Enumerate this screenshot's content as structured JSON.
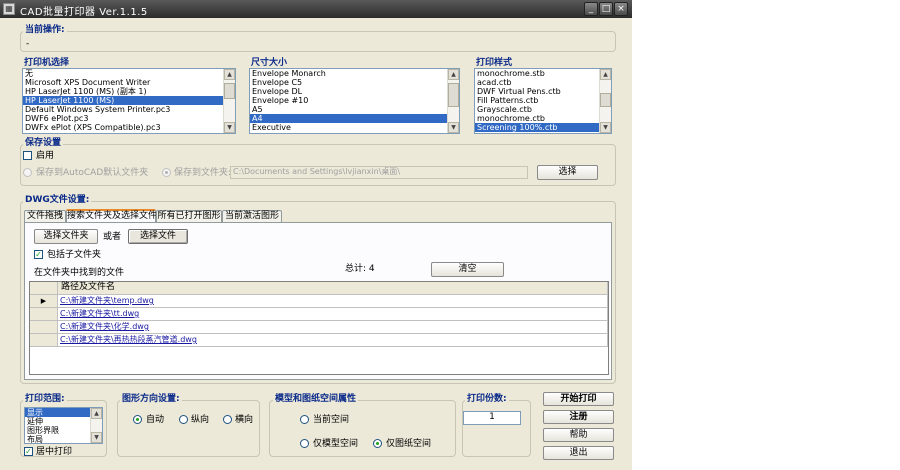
{
  "window": {
    "title": "CAD批量打印器 Ver.1.1.5",
    "controls": {
      "minimize": "_",
      "maximize": "□",
      "close": "×"
    }
  },
  "current_op": {
    "title": "当前操作:",
    "value": "-"
  },
  "printer": {
    "title": "打印机选择",
    "items": [
      "无",
      "Microsoft XPS Document Writer",
      "HP LaserJet 1100 (MS) (副本 1)",
      "HP LaserJet 1100 (MS)",
      "Default Windows System Printer.pc3",
      "DWF6 ePlot.pc3",
      "DWFx ePlot (XPS Compatible).pc3"
    ],
    "selected_index": 3
  },
  "size": {
    "title": "尺寸大小",
    "items": [
      "Envelope Monarch",
      "Envelope C5",
      "Envelope DL",
      "Envelope #10",
      "A5",
      "A4",
      "Executive"
    ],
    "selected_index": 5
  },
  "style": {
    "title": "打印样式",
    "items": [
      "monochrome.stb",
      "acad.ctb",
      "DWF Virtual Pens.ctb",
      "Fill Patterns.ctb",
      "Grayscale.ctb",
      "monochrome.ctb",
      "Screening 100%.ctb"
    ],
    "selected_index": 6
  },
  "save": {
    "title": "保存设置",
    "enable_label": "启用",
    "enabled": false,
    "option_default": "保存到AutoCAD默认文件夹",
    "option_folder": "保存到文件夹:",
    "folder_path": "C:\\Documents and Settings\\lvjianxin\\桌面\\",
    "choose_button": "选择"
  },
  "dwg": {
    "title": "DWG文件设置:",
    "tabs": [
      "文件拖拽",
      "搜索文件夹及选择文件",
      "所有已打开图形",
      "当前激活图形"
    ],
    "active_tab": 1,
    "select_folder_button": "选择文件夹",
    "or_label": "或者",
    "select_file_button": "选择文件",
    "include_subfolders": "包括子文件夹",
    "include_subfolders_checked": true,
    "found_label": "在文件夹中找到的文件",
    "total_label": "总计: 4",
    "clear_button": "清空",
    "column_header": "路径及文件名",
    "row_marker": "▶",
    "files": [
      "C:\\新建文件夹\\temp.dwg",
      "C:\\新建文件夹\\tt.dwg",
      "C:\\新建文件夹\\化学.dwg",
      "C:\\新建文件夹\\再热热段蒸汽管道.dwg"
    ]
  },
  "print_range": {
    "title": "打印范围:",
    "items": [
      "显示",
      "延伸",
      "图形界限",
      "布局"
    ],
    "selected_index": 0,
    "center_print": "居中打印",
    "center_print_checked": true
  },
  "orientation": {
    "title": "图形方向设置:",
    "options": [
      "自动",
      "纵向",
      "横向"
    ],
    "selected_index": 0
  },
  "space": {
    "title": "模型和图纸空间属性",
    "current": "当前空间",
    "model_only": "仅模型空间",
    "paper_only": "仅图纸空间",
    "selected": "paper_only"
  },
  "copies": {
    "title": "打印份数:",
    "value": "1"
  },
  "actions": {
    "start": "开始打印",
    "register": "注册",
    "help": "帮助",
    "exit": "退出"
  },
  "icons": {
    "check": "✓",
    "up_arrow": "▲",
    "down_arrow": "▼"
  }
}
